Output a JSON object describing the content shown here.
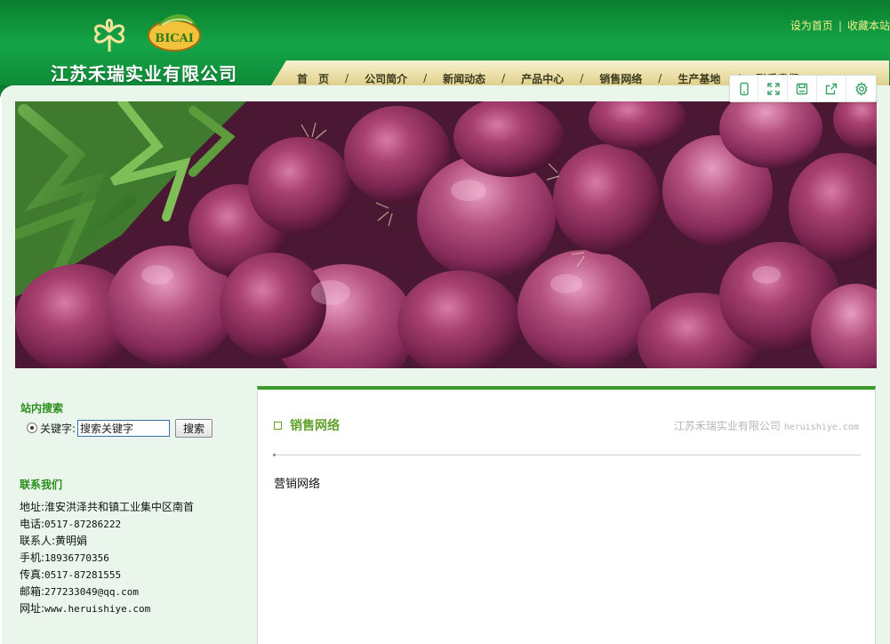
{
  "header": {
    "company_name": "江苏禾瑞实业有限公司",
    "badge_text": "BICAI",
    "top_links": [
      "设为首页",
      "收藏本站"
    ],
    "top_link_separator": "|"
  },
  "nav": {
    "items": [
      "首　页",
      "公司简介",
      "新闻动态",
      "产品中心",
      "销售网络",
      "生产基地",
      "联系我们"
    ],
    "separator": "/"
  },
  "toolbar": {
    "icons": [
      "phone-icon",
      "fullscreen-icon",
      "save-icon",
      "share-icon",
      "settings-icon"
    ]
  },
  "sidebar": {
    "search_title": "站内搜索",
    "search_label": "关键字:",
    "search_value": "搜索关键字",
    "search_button": "搜索",
    "contact_title": "联系我们",
    "contact": [
      {
        "label": "地址:",
        "value": "淮安洪泽共和镇工业集中区南首"
      },
      {
        "label": "电话:",
        "value": "0517-87286222"
      },
      {
        "label": "联系人:",
        "value": "黄明娟"
      },
      {
        "label": "手机:",
        "value": "18936770356"
      },
      {
        "label": "传真:",
        "value": "0517-87281555"
      },
      {
        "label": "邮箱:",
        "value": "277233049@qq.com"
      },
      {
        "label": "网址:",
        "value": "www.heruishiye.com"
      }
    ]
  },
  "main": {
    "section_title": "销售网络",
    "site_name": "江苏禾瑞实业有限公司",
    "site_domain": "heruishiye.com",
    "body_text": "营销网络"
  },
  "colors": {
    "header_green": "#15a548",
    "page_bg": "#e9f5ea",
    "accent_green": "#3a9a2a",
    "title_green": "#63a22d",
    "nav_gold": "#e7d89b",
    "top_link_yellow": "#f3f08a"
  }
}
